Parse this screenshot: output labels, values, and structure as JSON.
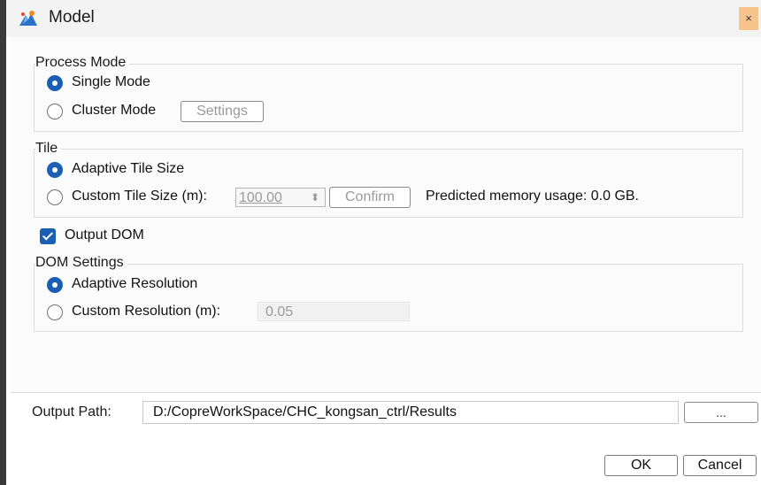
{
  "window": {
    "title": "Model",
    "close_glyph": "×"
  },
  "process_mode": {
    "label": "Process Mode",
    "options": [
      {
        "label": "Single Mode",
        "selected": true
      },
      {
        "label": "Cluster Mode",
        "selected": false
      }
    ],
    "settings_button": "Settings"
  },
  "tile": {
    "label": "Tile",
    "adaptive_label": "Adaptive Tile Size",
    "custom_label": "Custom Tile Size (m):",
    "custom_value": "100.00",
    "spin_glyph": "⬍",
    "confirm_button": "Confirm",
    "memory_text": "Predicted memory usage: 0.0 GB.",
    "selected": "adaptive"
  },
  "output_dom": {
    "label": "Output DOM",
    "checked": true
  },
  "dom_settings": {
    "label": "DOM Settings",
    "adaptive_label": "Adaptive Resolution",
    "custom_label": "Custom Resolution (m):",
    "custom_value": "0.05",
    "selected": "adaptive"
  },
  "output_path": {
    "label": "Output Path:",
    "value": "D:/CopreWorkSpace/CHC_kongsan_ctrl/Results",
    "browse_label": "..."
  },
  "buttons": {
    "ok": "OK",
    "cancel": "Cancel"
  },
  "colors": {
    "accent": "#1a5fb4",
    "close_bg": "#f7c48c"
  }
}
